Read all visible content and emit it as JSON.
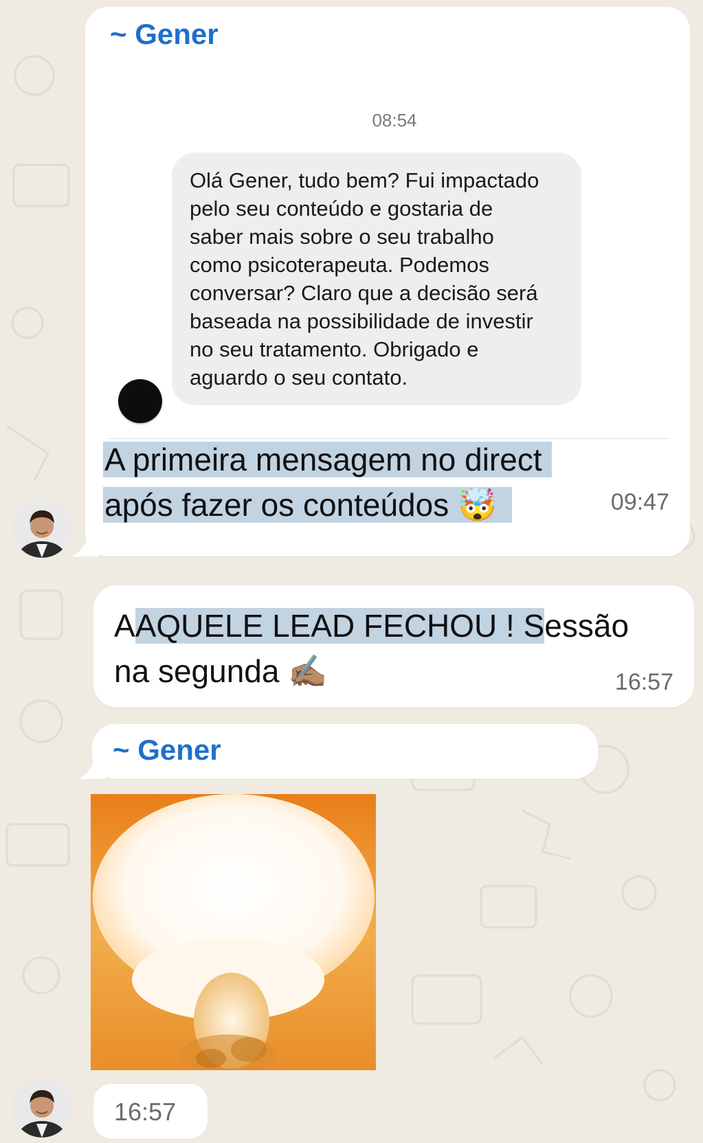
{
  "colors": {
    "chat_background": "#efeae2",
    "bubble": "#ffffff",
    "sender_name": "#1f6fc9",
    "highlight": "#c2d3e2",
    "quote_bubble": "#eeeef0"
  },
  "messages": [
    {
      "sender": "~ Gener",
      "screenshot": {
        "time": "08:54",
        "lines": [
          "Olá Gener, tudo bem? Fui impactado",
          "pelo seu conteúdo e gostaria de",
          "saber mais sobre o seu trabalho",
          "como psicoterapeuta. Podemos",
          "conversar? Claro que a decisão será",
          "baseada na possibilidade de investir",
          "no seu tratamento. Obrigado e",
          "aguardo o seu contato."
        ]
      },
      "caption_line1": "A primeira mensagem no direct",
      "caption_line2": "após fazer os conteúdos",
      "emoji": "🤯",
      "time": "09:47"
    },
    {
      "text_part1": "AQUELE LEAD FECHOU ! S",
      "text_part2": "essão",
      "text_line2": "na segunda",
      "emoji": "✍🏽",
      "time": "16:57"
    },
    {
      "sender": "~ Gener",
      "media": "explosion-gif",
      "time": "16:57"
    }
  ]
}
